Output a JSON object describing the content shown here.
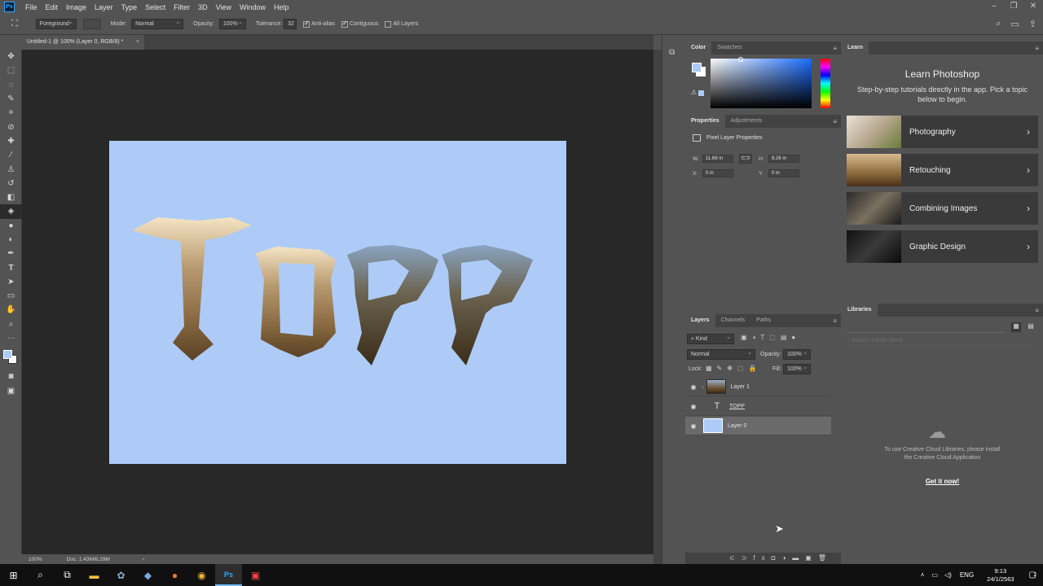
{
  "app": {
    "logo": "Ps"
  },
  "menu": [
    "File",
    "Edit",
    "Image",
    "Layer",
    "Type",
    "Select",
    "Filter",
    "3D",
    "View",
    "Window",
    "Help"
  ],
  "options": {
    "fill_source": "Foreground",
    "mode_label": "Mode:",
    "mode_value": "Normal",
    "opacity_label": "Opacity:",
    "opacity_value": "100%",
    "tolerance_label": "Tolerance:",
    "tolerance_value": "32",
    "antialias": "Anti-alias",
    "contiguous": "Contiguous",
    "all_layers": "All Layers"
  },
  "document": {
    "tab_title": "Untitled-1 @ 100% (Layer 0, RGB/8) *",
    "artwork_text": "TOPP",
    "zoom": "100%",
    "doc_size": "Doc: 1.43M/6.29M"
  },
  "colors": {
    "foreground": "#aecbf7",
    "background": "#ffffff",
    "artboard": "#aecbf7"
  },
  "panels": {
    "color_tabs": [
      "Color",
      "Swatches"
    ],
    "properties_tabs": [
      "Properties",
      "Adjustments"
    ],
    "properties_title": "Pixel Layer Properties",
    "w_label": "W:",
    "w_value": "11.69 in",
    "h_label": "H:",
    "h_value": "8.26 in",
    "x_label": "X:",
    "x_value": "0 in",
    "y_label": "Y:",
    "y_value": "0 in",
    "layers_tabs": [
      "Layers",
      "Channels",
      "Paths"
    ],
    "kind_filter": "Kind",
    "blend_mode": "Normal",
    "opacity_label": "Opacity:",
    "opacity_value": "100%",
    "lock_label": "Lock:",
    "fill_label": "Fill:",
    "fill_value": "100%",
    "layers": [
      {
        "name": "Layer 1",
        "type": "image"
      },
      {
        "name": "TOPP",
        "type": "text"
      },
      {
        "name": "Layer 0",
        "type": "fill"
      }
    ]
  },
  "learn": {
    "tab": "Learn",
    "title": "Learn Photoshop",
    "subtitle": "Step-by-step tutorials directly in the app. Pick a topic below to begin.",
    "topics": [
      "Photography",
      "Retouching",
      "Combining Images",
      "Graphic Design"
    ]
  },
  "libraries": {
    "tab": "Libraries",
    "search_placeholder": "Search Adobe Stock",
    "message": "To use Creative Cloud Libraries, please install the Creative Cloud Application",
    "link": "Get it now!"
  },
  "taskbar": {
    "language": "ENG",
    "time": "9:13",
    "date": "24/1/2563",
    "notifications": "2"
  }
}
